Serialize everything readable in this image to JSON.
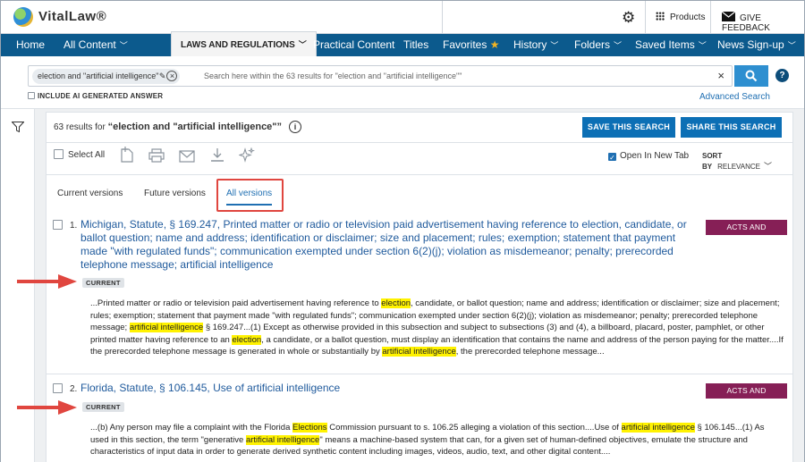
{
  "brand": {
    "name": "VitalLaw®"
  },
  "topbar": {
    "products_label": "Products",
    "feedback_label": "GIVE FEEDBACK"
  },
  "nav": {
    "home": "Home",
    "all_content": "All Content",
    "laws": "LAWS AND REGULATIONS",
    "practical": "Practical Content",
    "titles": "Titles",
    "favorites": "Favorites",
    "history": "History",
    "folders": "Folders",
    "saved": "Saved Items",
    "news": "News Sign-up"
  },
  "search": {
    "chip": "election and \"artificial intelligence\"",
    "placeholder": "Search here within the 63 results for \"election and \"artificial intelligence\"\"",
    "ai_label": "INCLUDE AI GENERATED ANSWER",
    "advanced": "Advanced Search"
  },
  "results_header": {
    "count_prefix": "63 results for ",
    "query": "“election and \"artificial intelligence\"”",
    "save_btn": "SAVE THIS SEARCH",
    "share_btn": "SHARE THIS SEARCH",
    "select_all": "Select All",
    "open_new_tab": "Open In New Tab",
    "sort_label": "SORT BY",
    "sort_value": "RELEVANCE"
  },
  "tabs": [
    "Current versions",
    "Future versions",
    "All versions"
  ],
  "results": [
    {
      "num": "1.",
      "title": "Michigan, Statute, § 169.247, Printed matter or radio or television paid advertisement having reference to election, candidate, or ballot question; name and address; identification or disclaimer; size and placement; rules; exemption; statement that payment made \"with regulated funds\"; communication exempted under section 6(2)(j); violation as misdemeanor; penalty; prerecorded telephone message; artificial intelligence",
      "badge": "ACTS AND STATUTES",
      "status": "CURRENT",
      "s1": "...Printed matter or radio or television paid advertisement having reference to ",
      "h1": "election",
      "s2": ", candidate, or ballot question; name and address; identification or disclaimer; size and placement; rules; exemption; statement that payment made \"with regulated funds\"; communication exempted under section 6(2)(j); violation as misdemeanor; penalty; prerecorded telephone message; ",
      "h2": "artificial intelligence",
      "s3": " § 169.247...(1) Except as otherwise provided in this subsection and subject to subsections (3) and (4), a billboard, placard, poster, pamphlet, or other printed matter having reference to an ",
      "h3": "election",
      "s4": ", a candidate, or a ballot question, must display an identification that contains the name and address of the person paying for the matter....If the prerecorded telephone message is generated in whole or substantially by ",
      "h4": "artificial intelligence",
      "s5": ", the prerecorded telephone message..."
    },
    {
      "num": "2.",
      "title": "Florida, Statute, § 106.145, Use of artificial intelligence",
      "badge": "ACTS AND STATUTES",
      "status": "CURRENT",
      "s1": "...(b) Any person may file a complaint with the Florida ",
      "h1": "Elections",
      "s2": " Commission pursuant to s. 106.25 alleging a violation of this section....Use of ",
      "h2": "artificial intelligence",
      "s3": " § 106.145...(1) As used in this section, the term \"generative ",
      "h3": "artificial intelligence",
      "s4": "\" means a machine-based system that can, for a given set of human-defined objectives, emulate the structure and characteristics of input data in order to generate derived synthetic content including images, videos, audio, text, and other digital content...."
    }
  ]
}
